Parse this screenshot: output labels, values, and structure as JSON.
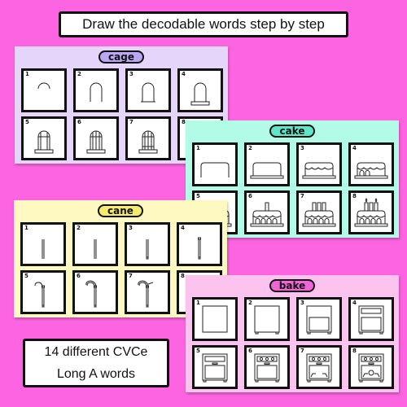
{
  "header": {
    "title": "Draw the decodable words step by step"
  },
  "info": {
    "line1": "14 different CVCe",
    "line2": "Long A words"
  },
  "panels": [
    {
      "word": "cage",
      "bg": "#e5d5fb",
      "pill": "#bca7f5",
      "steps": [
        "1",
        "2",
        "3",
        "4",
        "5",
        "6",
        "7",
        "8"
      ]
    },
    {
      "word": "cake",
      "bg": "#b2fbe6",
      "pill": "#5fe6c8",
      "steps": [
        "1",
        "2",
        "3",
        "4",
        "5",
        "6",
        "7",
        "8"
      ]
    },
    {
      "word": "cane",
      "bg": "#fef9c0",
      "pill": "#f6ec6a",
      "steps": [
        "1",
        "2",
        "3",
        "4",
        "5",
        "6",
        "7",
        "8"
      ]
    },
    {
      "word": "bake",
      "bg": "#fdc3ef",
      "pill": "#f463d8",
      "steps": [
        "1",
        "2",
        "3",
        "4",
        "5",
        "6",
        "7",
        "8"
      ]
    }
  ],
  "colors": {
    "background": "#fd64e1",
    "border": "#111111"
  }
}
